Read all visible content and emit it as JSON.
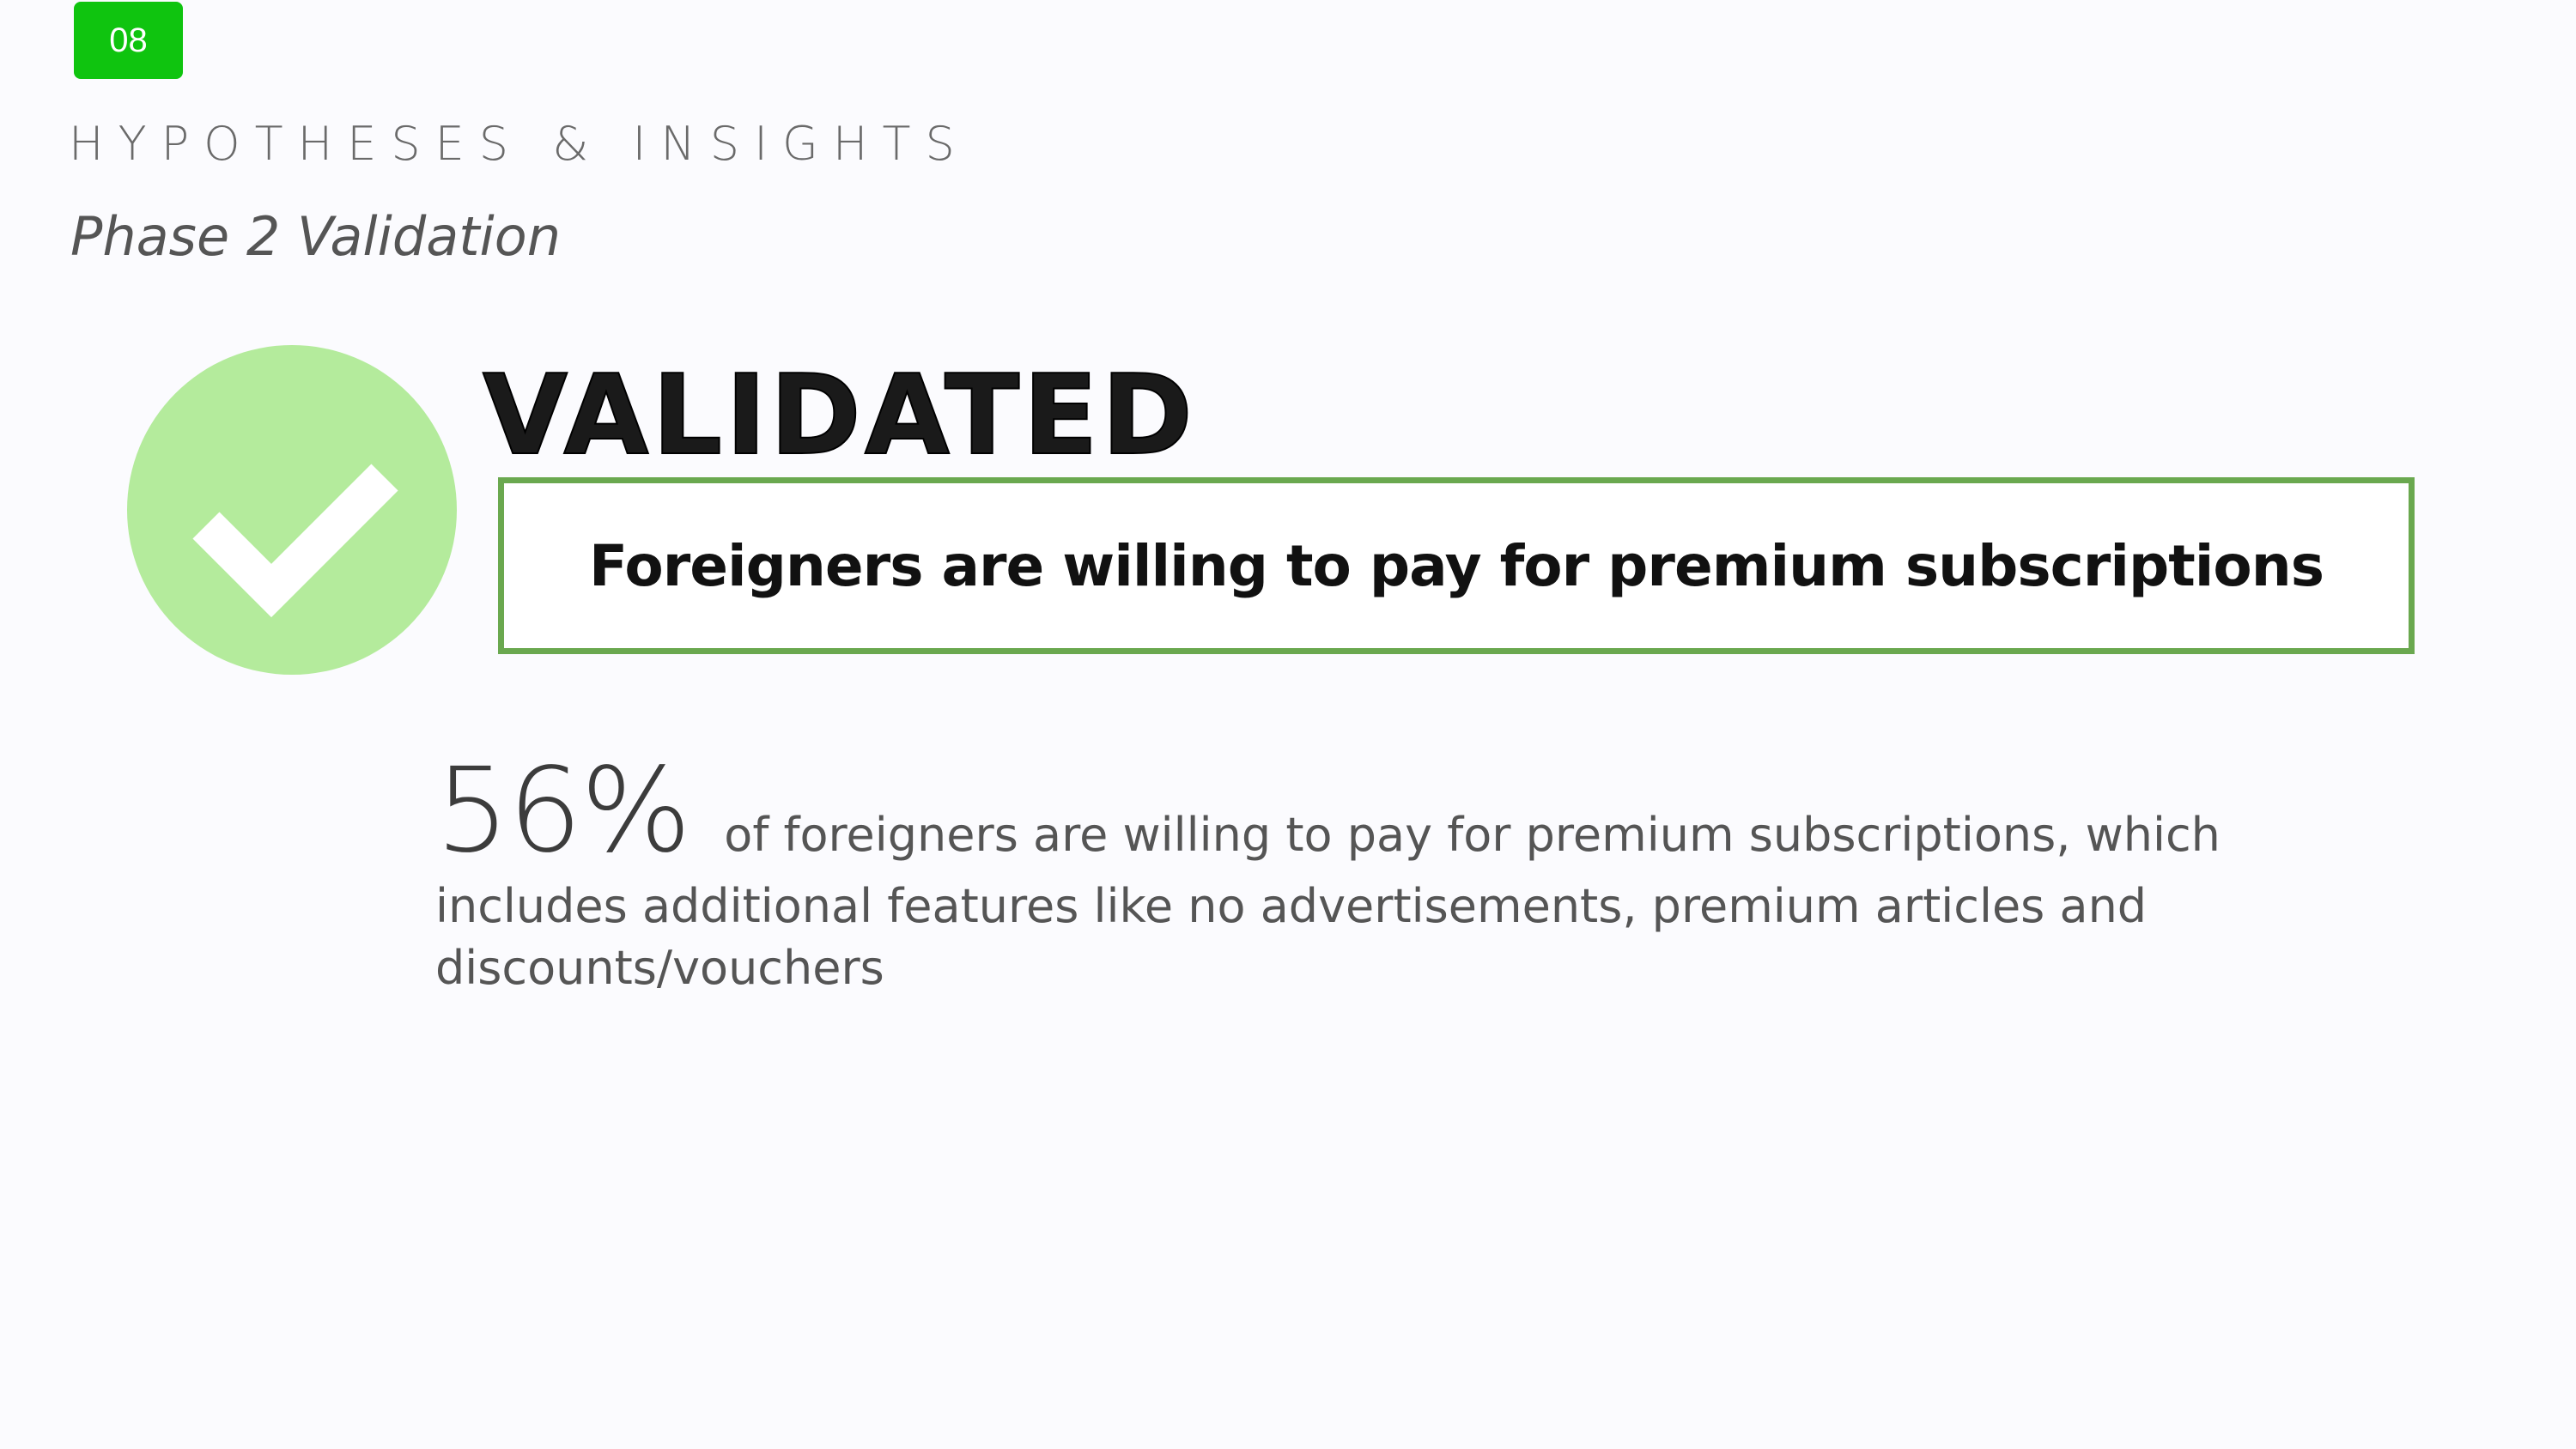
{
  "slide": {
    "number": "08",
    "section_title": "HYPOTHESES & INSIGHTS",
    "subtitle": "Phase 2 Validation"
  },
  "status": {
    "icon": "check-circle-icon",
    "label": "VALIDATED",
    "circle_color": "#b4eb9c",
    "accent_color": "#6aa84f"
  },
  "hypothesis": {
    "text": "Foreigners are willing to pay for premium subscriptions"
  },
  "finding": {
    "value": "56%",
    "text_first_line": "of foreigners are willing to pay for premium subscriptions, which",
    "text_rest": "includes additional features like no advertisements, premium articles and discounts/vouchers"
  },
  "colors": {
    "badge": "#0fc40f",
    "background": "#fbfbfe"
  }
}
